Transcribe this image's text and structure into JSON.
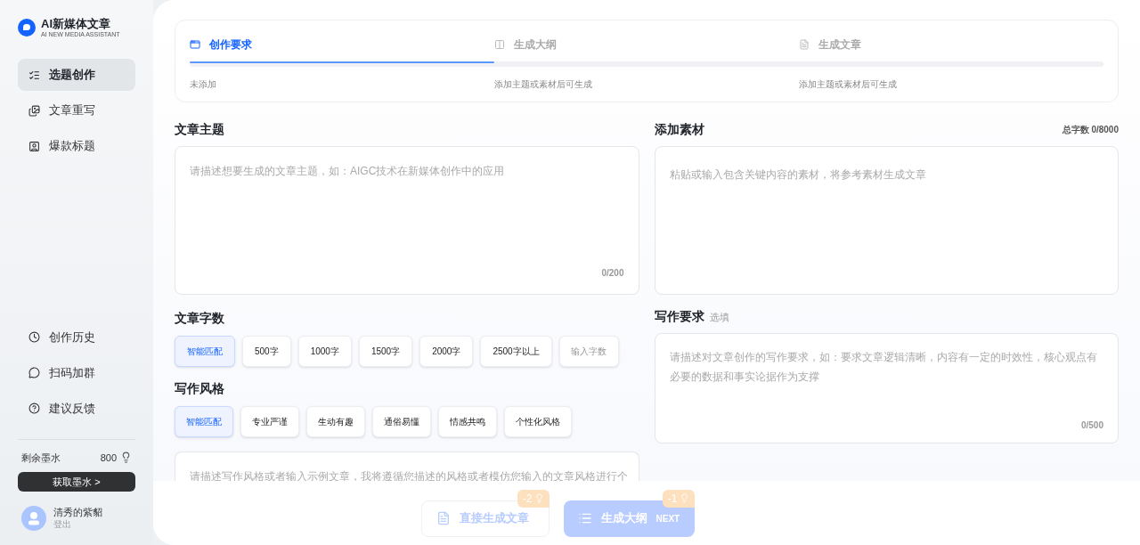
{
  "brand": {
    "title": "AI新媒体文章",
    "subtitle": "AI NEW MEDIA ASSISTANT"
  },
  "nav": [
    {
      "label": "选题创作",
      "selected": true
    },
    {
      "label": "文章重写",
      "selected": false
    },
    {
      "label": "爆款标题",
      "selected": false
    }
  ],
  "nav_bottom": [
    {
      "label": "创作历史"
    },
    {
      "label": "扫码加群"
    },
    {
      "label": "建议反馈"
    }
  ],
  "ink": {
    "label": "剩余墨水",
    "value": "800",
    "button": "获取墨水 >"
  },
  "user": {
    "name": "清秀的紫貂",
    "action": "登出"
  },
  "steps": [
    {
      "title": "创作要求",
      "note": "未添加",
      "selected": true
    },
    {
      "title": "生成大纲",
      "note": "添加主题或素材后可生成",
      "selected": false
    },
    {
      "title": "生成文章",
      "note": "添加主题或素材后可生成",
      "selected": false
    }
  ],
  "topic": {
    "heading": "文章主题",
    "placeholder": "请描述想要生成的文章主题，如：AIGC技术在新媒体创作中的应用",
    "counter": "0/200"
  },
  "material": {
    "heading": "添加素材",
    "total": "总字数 0/8000",
    "placeholder": "粘贴或输入包含关键内容的素材，将参考素材生成文章"
  },
  "length": {
    "heading": "文章字数",
    "options": [
      {
        "kind": "option",
        "label": "智能匹配",
        "selected": true
      },
      {
        "kind": "option",
        "label": "500字",
        "selected": false
      },
      {
        "kind": "option",
        "label": "1000字",
        "selected": false
      },
      {
        "kind": "option",
        "label": "1500字",
        "selected": false
      },
      {
        "kind": "option",
        "label": "2000字",
        "selected": false
      },
      {
        "kind": "option",
        "label": "2500字以上",
        "selected": false
      },
      {
        "kind": "input",
        "placeholder": "输入字数",
        "selected": false
      }
    ]
  },
  "style": {
    "heading": "写作风格",
    "options": [
      {
        "label": "智能匹配",
        "selected": true
      },
      {
        "label": "专业严谨",
        "selected": false
      },
      {
        "label": "生动有趣",
        "selected": false
      },
      {
        "label": "通俗易懂",
        "selected": false
      },
      {
        "label": "情感共鸣",
        "selected": false
      },
      {
        "label": "个性化风格",
        "selected": false
      }
    ],
    "placeholder": "请描述写作风格或者输入示例文章，我将遵循您描述的风格或者模仿您输入的文章风格进行个"
  },
  "requirements": {
    "heading": "写作要求",
    "optional": "选填",
    "placeholder": "请描述对文章创作的写作要求，如：要求文章逻辑清晰，内容有一定的时效性，核心观点有必要的数据和事实论据作为支撑",
    "counter": "0/500"
  },
  "actions": [
    {
      "kind": "secondary",
      "label": "直接生成文章",
      "cost": "-2",
      "disabled": true
    },
    {
      "kind": "primary",
      "label": "生成大纲",
      "hint": "NEXT",
      "cost": "-1",
      "disabled": true
    }
  ]
}
